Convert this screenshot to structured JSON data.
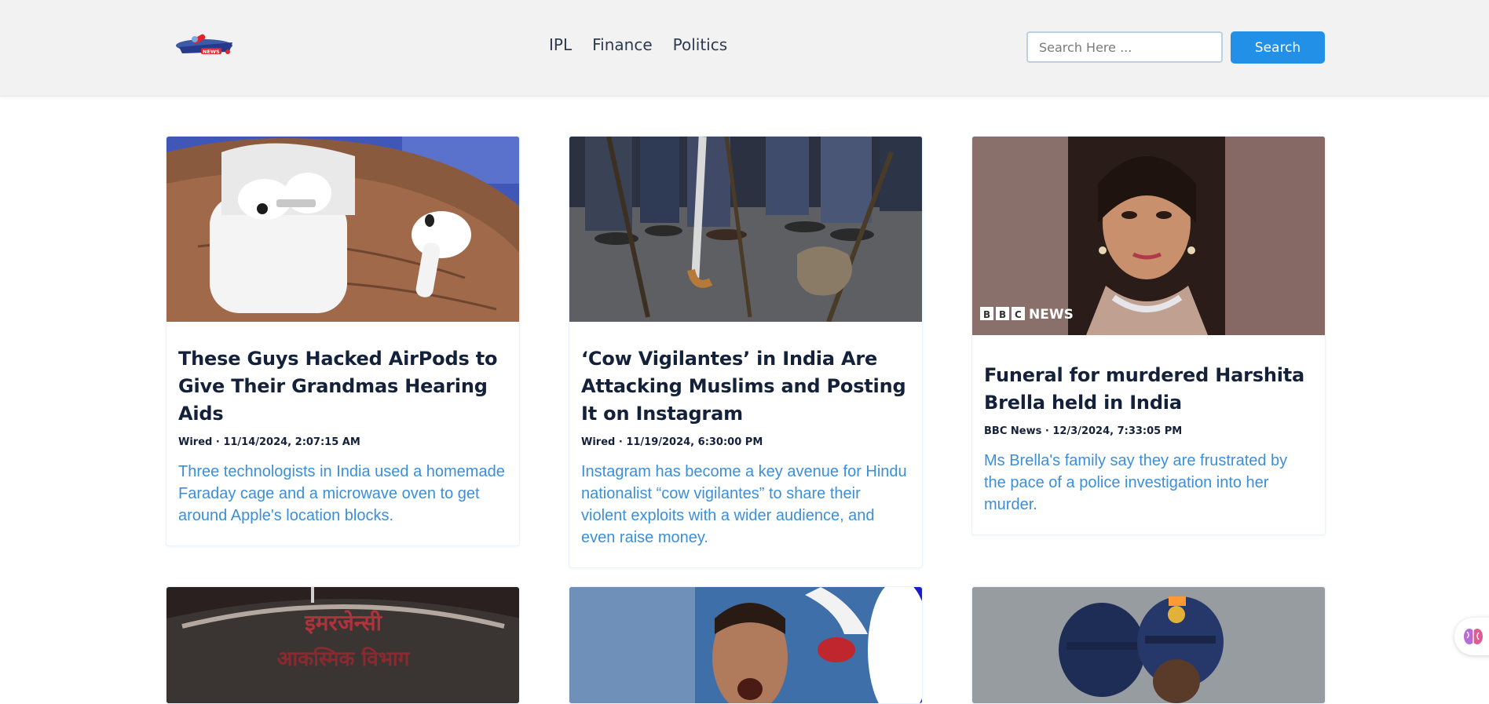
{
  "header": {
    "logo_text": "NEWS",
    "nav": [
      "IPL",
      "Finance",
      "Politics"
    ],
    "search_placeholder": "Search Here ...",
    "search_button": "Search"
  },
  "articles": [
    {
      "title": "These Guys Hacked AirPods to Give Their Grandmas Hearing Aids",
      "meta": "Wired · 11/14/2024, 2:07:15 AM",
      "description": "Three technologists in India used a homemade Faraday cage and a microwave oven to get around Apple's location blocks."
    },
    {
      "title": "‘Cow Vigilantes’ in India Are Attacking Muslims and Posting It on Instagram",
      "meta": "Wired · 11/19/2024, 6:30:00 PM",
      "description": "Instagram has become a key avenue for Hindu nationalist “cow vigilantes” to share their violent exploits with a wider audience, and even raise money."
    },
    {
      "title": "Funeral for murdered Harshita Brella held in India",
      "meta": "BBC News · 12/3/2024, 7:33:05 PM",
      "description": "Ms Brella's family say they are frustrated by the pace of a police investigation into her murder.",
      "image_overlay": "NEWS"
    }
  ],
  "bottom_images": {
    "emergency_sign_line1": "इमरजेन्सी",
    "emergency_sign_line2": "आकस्मिक विभाग"
  },
  "colors": {
    "accent": "#2190e6",
    "title": "#14213a",
    "description": "#3b8fd9",
    "navbar_bg": "#f2f2f3"
  }
}
